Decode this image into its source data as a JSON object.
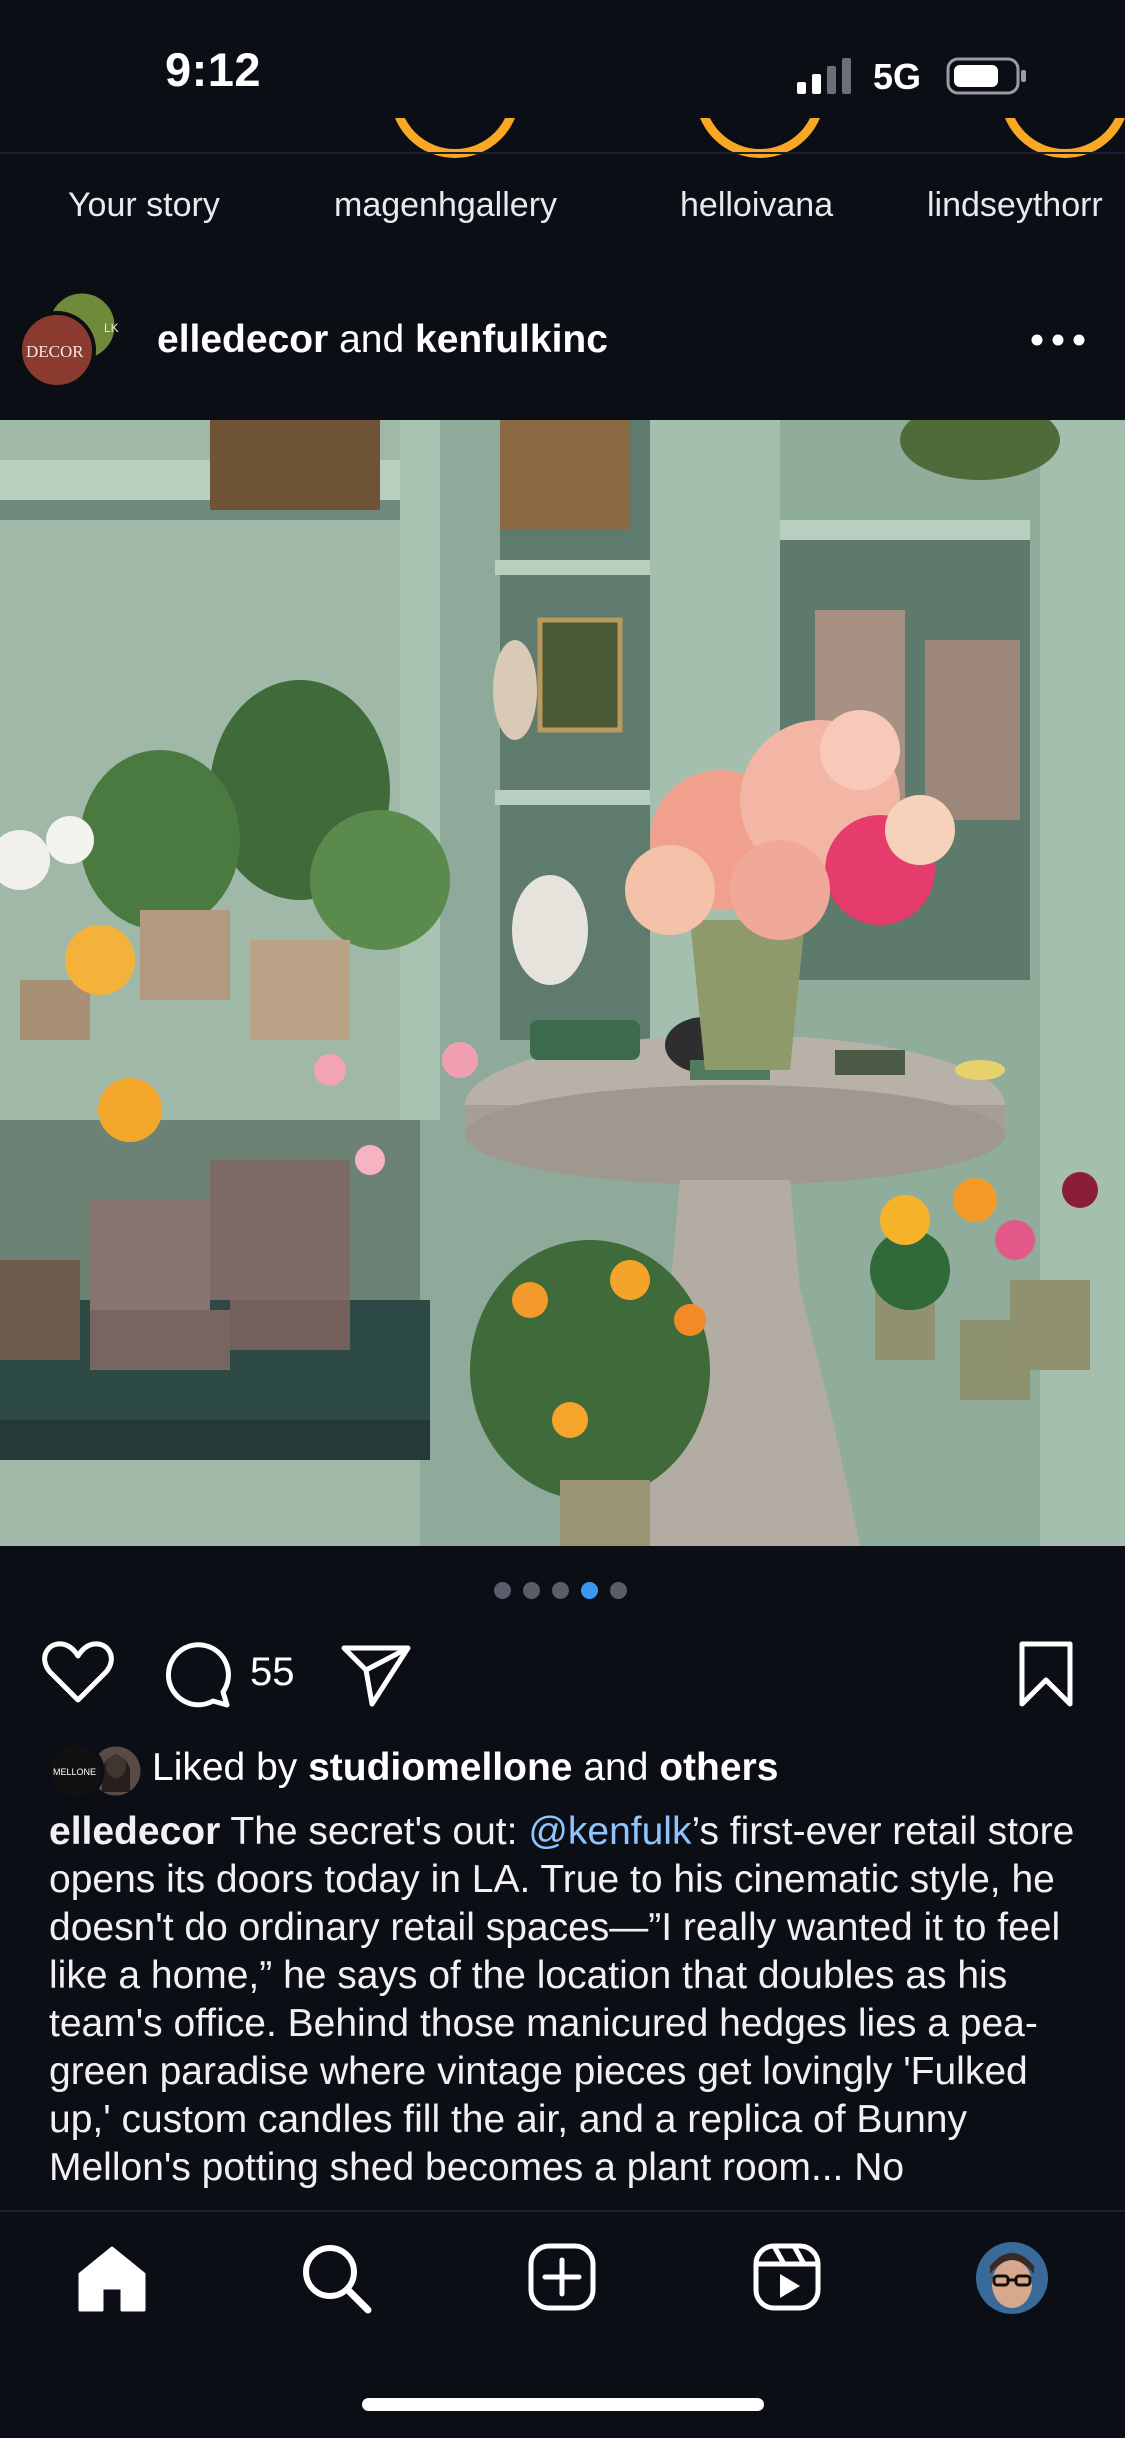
{
  "status_bar": {
    "time": "9:12",
    "network": "5G"
  },
  "stories": [
    {
      "label": "Your story"
    },
    {
      "label": "magenhgallery"
    },
    {
      "label": "helloivana"
    },
    {
      "label": "lindseythorr"
    }
  ],
  "post": {
    "author": "elledecor",
    "conjunction": "and",
    "coauthor": "kenfulkinc",
    "avatar_text": "DECOR",
    "image_alt": "Shop interior with plants, flowers and a stone pedestal table",
    "carousel": {
      "count": 5,
      "active_index": 3
    },
    "comment_count": "55",
    "likes": {
      "prefix": "Liked by",
      "user": "studiomellone",
      "middle": "and",
      "suffix": "others",
      "avatar_text": "MELLONE"
    },
    "caption": {
      "author": "elledecor",
      "text_before": " The secret's out: ",
      "mention": "@kenfulk",
      "text_after": "’s first-ever retail store opens its doors today in LA. True to his cinematic style, he doesn't do ordinary retail spaces—”I really wanted it to feel like a home,” he says of the location that doubles as his team's office. Behind those manicured hedges lies a pea-green paradise where vintage pieces get lovingly 'Fulked up,' custom candles fill the air, and a replica of Bunny Mellon's potting shed becomes a plant room... No"
    }
  },
  "colors": {
    "background": "#0c0e15",
    "story_ring": "#f9a825",
    "link": "#8fc4ff",
    "active_dot": "#3897f0"
  },
  "icons": [
    "signal-icon",
    "battery-icon",
    "more-icon",
    "heart-icon",
    "comment-icon",
    "share-icon",
    "bookmark-icon",
    "home-icon",
    "search-icon",
    "create-icon",
    "reels-icon",
    "profile-avatar"
  ]
}
